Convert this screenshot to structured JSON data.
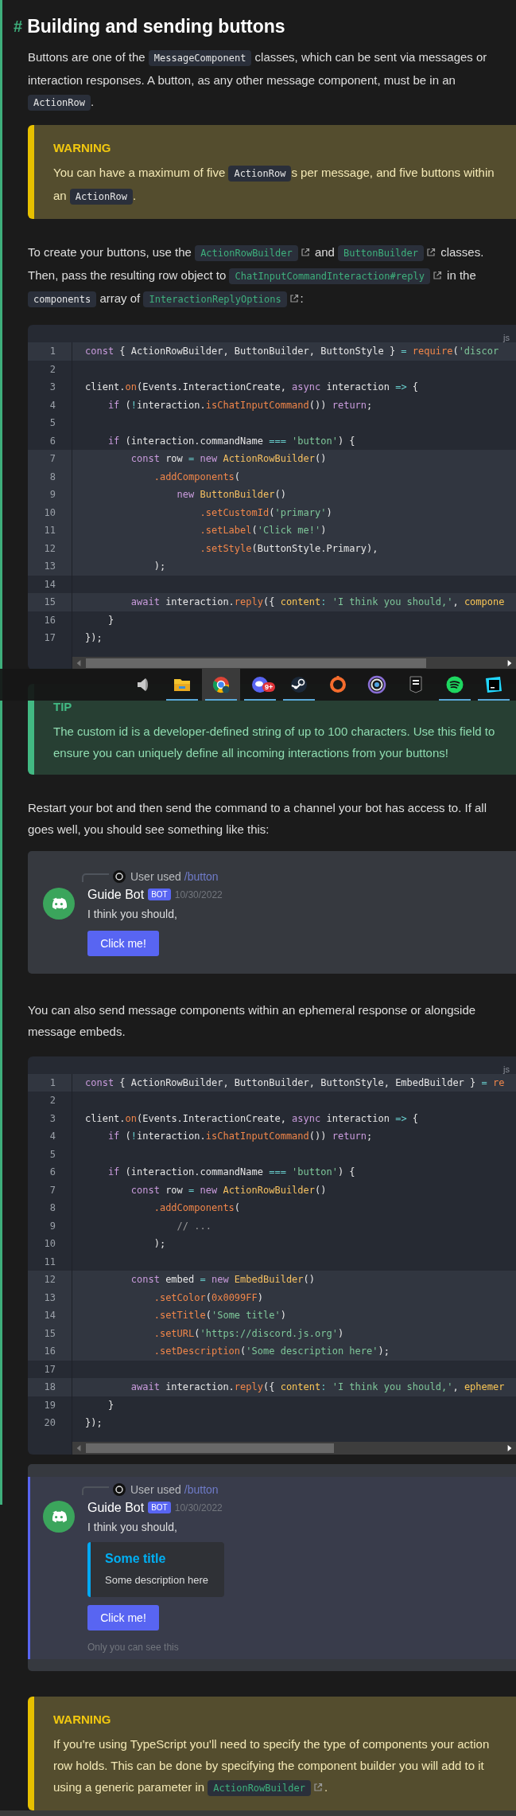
{
  "heading": {
    "anchor": "#",
    "title": "Building and sending buttons"
  },
  "blocks": [
    {
      "kind": "paragraph",
      "segments": [
        {
          "kind": "text",
          "text": "Buttons are one of the "
        },
        {
          "kind": "code",
          "text": "MessageComponent"
        },
        {
          "kind": "text",
          "text": " classes, which can be sent via messages or interaction responses. A button, as any other message component, must be in an "
        },
        {
          "kind": "code",
          "text": "ActionRow"
        },
        {
          "kind": "text",
          "text": "."
        }
      ]
    },
    {
      "kind": "warning",
      "title": "WARNING",
      "segments": [
        {
          "kind": "text",
          "text": "You can have a maximum of five "
        },
        {
          "kind": "code",
          "text": "ActionRow"
        },
        {
          "kind": "text",
          "text": "s per message, and five buttons within an "
        },
        {
          "kind": "code",
          "text": "ActionRow"
        },
        {
          "kind": "text",
          "text": "."
        }
      ]
    },
    {
      "kind": "paragraph",
      "segments": [
        {
          "kind": "text",
          "text": "To create your buttons, use the "
        },
        {
          "kind": "link",
          "text": "ActionRowBuilder"
        },
        {
          "kind": "text",
          "text": " and "
        },
        {
          "kind": "link",
          "text": "ButtonBuilder"
        },
        {
          "kind": "text",
          "text": " classes. Then, pass the resulting row object to "
        },
        {
          "kind": "link",
          "text": "ChatInputCommandInteraction#reply"
        },
        {
          "kind": "text",
          "text": " in the "
        },
        {
          "kind": "code",
          "text": "components"
        },
        {
          "kind": "text",
          "text": " array of "
        },
        {
          "kind": "link",
          "text": "InteractionReplyOptions"
        },
        {
          "kind": "text",
          "text": ":"
        }
      ]
    },
    {
      "kind": "code",
      "language": "js",
      "lines": [
        {
          "n": "1",
          "highlighted": true,
          "tokens": [
            {
              "kind": "kw",
              "text": "const"
            },
            {
              "kind": "p",
              "text": " { ActionRowBuilder, ButtonBuilder, ButtonStyle } "
            },
            {
              "kind": "op",
              "text": "="
            },
            {
              "kind": "fn",
              "text": " require"
            },
            {
              "kind": "p",
              "text": "("
            },
            {
              "kind": "str",
              "text": "'discor"
            }
          ]
        },
        {
          "n": "2",
          "highlighted": false
        },
        {
          "n": "3",
          "highlighted": false,
          "tokens": [
            {
              "kind": "p",
              "text": "client."
            },
            {
              "kind": "fn",
              "text": "on"
            },
            {
              "kind": "p",
              "text": "(Events.InteractionCreate, "
            },
            {
              "kind": "kw",
              "text": "async"
            },
            {
              "kind": "p",
              "text": " interaction "
            },
            {
              "kind": "op",
              "text": "=>"
            },
            {
              "kind": "p",
              "text": " {"
            }
          ]
        },
        {
          "n": "4",
          "highlighted": false,
          "tokens": [
            {
              "kind": "kw",
              "text": "    if"
            },
            {
              "kind": "p",
              "text": " ("
            },
            {
              "kind": "op",
              "text": "!"
            },
            {
              "kind": "p",
              "text": "interaction."
            },
            {
              "kind": "fn",
              "text": "isChatInputCommand"
            },
            {
              "kind": "p",
              "text": "()) "
            },
            {
              "kind": "kw",
              "text": "return"
            },
            {
              "kind": "p",
              "text": ";"
            }
          ]
        },
        {
          "n": "5",
          "highlighted": false
        },
        {
          "n": "6",
          "highlighted": false,
          "tokens": [
            {
              "kind": "kw",
              "text": "    if"
            },
            {
              "kind": "p",
              "text": " (interaction.commandName "
            },
            {
              "kind": "op",
              "text": "==="
            },
            {
              "kind": "str",
              "text": " 'button'"
            },
            {
              "kind": "p",
              "text": ") {"
            }
          ]
        },
        {
          "n": "7",
          "highlighted": true,
          "tokens": [
            {
              "kind": "kw",
              "text": "        const"
            },
            {
              "kind": "p",
              "text": " row "
            },
            {
              "kind": "op",
              "text": "="
            },
            {
              "kind": "kw",
              "text": " new"
            },
            {
              "kind": "cls",
              "text": " ActionRowBuilder"
            },
            {
              "kind": "p",
              "text": "()"
            }
          ]
        },
        {
          "n": "8",
          "highlighted": true,
          "tokens": [
            {
              "kind": "fn",
              "text": "            .addComponents"
            },
            {
              "kind": "p",
              "text": "("
            }
          ]
        },
        {
          "n": "9",
          "highlighted": true,
          "tokens": [
            {
              "kind": "kw",
              "text": "                new"
            },
            {
              "kind": "cls",
              "text": " ButtonBuilder"
            },
            {
              "kind": "p",
              "text": "()"
            }
          ]
        },
        {
          "n": "10",
          "highlighted": true,
          "tokens": [
            {
              "kind": "fn",
              "text": "                    .setCustomId"
            },
            {
              "kind": "p",
              "text": "("
            },
            {
              "kind": "str",
              "text": "'primary'"
            },
            {
              "kind": "p",
              "text": ")"
            }
          ]
        },
        {
          "n": "11",
          "highlighted": true,
          "tokens": [
            {
              "kind": "fn",
              "text": "                    .setLabel"
            },
            {
              "kind": "p",
              "text": "("
            },
            {
              "kind": "str",
              "text": "'Click me!'"
            },
            {
              "kind": "p",
              "text": ")"
            }
          ]
        },
        {
          "n": "12",
          "highlighted": true,
          "tokens": [
            {
              "kind": "fn",
              "text": "                    .setStyle"
            },
            {
              "kind": "p",
              "text": "(ButtonStyle.Primary),"
            }
          ]
        },
        {
          "n": "13",
          "highlighted": true,
          "tokens": [
            {
              "kind": "p",
              "text": "            );"
            }
          ]
        },
        {
          "n": "14",
          "highlighted": false
        },
        {
          "n": "15",
          "highlighted": true,
          "tokens": [
            {
              "kind": "kw",
              "text": "        await"
            },
            {
              "kind": "p",
              "text": " interaction."
            },
            {
              "kind": "fn",
              "text": "reply"
            },
            {
              "kind": "p",
              "text": "({ "
            },
            {
              "kind": "prop",
              "text": "content"
            },
            {
              "kind": "op",
              "text": ":"
            },
            {
              "kind": "str",
              "text": " 'I think you should,'"
            },
            {
              "kind": "p",
              "text": ", "
            },
            {
              "kind": "prop",
              "text": "compone"
            }
          ]
        },
        {
          "n": "16",
          "highlighted": false,
          "tokens": [
            {
              "kind": "p",
              "text": "    }"
            }
          ]
        },
        {
          "n": "17",
          "highlighted": false,
          "tokens": [
            {
              "kind": "p",
              "text": "});"
            }
          ]
        }
      ]
    },
    {
      "kind": "tip",
      "title": "TIP",
      "segments": [
        {
          "kind": "text",
          "text": "The custom id is a developer-defined string of up to 100 characters. Use this field to ensure you can uniquely define all incoming interactions from your buttons!"
        }
      ]
    },
    {
      "kind": "paragraph",
      "segments": [
        {
          "kind": "text",
          "text": "Restart your bot and then send the command to a channel your bot has access to. If all goes well, you should see something like this:"
        }
      ]
    },
    {
      "kind": "discord",
      "ephemeral": false,
      "reply_text": "User used",
      "command": "/button",
      "author": "Guide Bot",
      "tag": "BOT",
      "timestamp": "10/30/2022",
      "content": "I think you should,",
      "button": "Click me!"
    },
    {
      "kind": "paragraph",
      "segments": [
        {
          "kind": "text",
          "text": "You can also send message components within an ephemeral response or alongside message embeds."
        }
      ]
    },
    {
      "kind": "code",
      "language": "js",
      "lines": [
        {
          "n": "1",
          "highlighted": true,
          "tokens": [
            {
              "kind": "kw",
              "text": "const"
            },
            {
              "kind": "p",
              "text": " { ActionRowBuilder, ButtonBuilder, ButtonStyle, EmbedBuilder } "
            },
            {
              "kind": "op",
              "text": "="
            },
            {
              "kind": "fn",
              "text": " re"
            }
          ]
        },
        {
          "n": "2",
          "highlighted": false
        },
        {
          "n": "3",
          "highlighted": false,
          "tokens": [
            {
              "kind": "p",
              "text": "client."
            },
            {
              "kind": "fn",
              "text": "on"
            },
            {
              "kind": "p",
              "text": "(Events.InteractionCreate, "
            },
            {
              "kind": "kw",
              "text": "async"
            },
            {
              "kind": "p",
              "text": " interaction "
            },
            {
              "kind": "op",
              "text": "=>"
            },
            {
              "kind": "p",
              "text": " {"
            }
          ]
        },
        {
          "n": "4",
          "highlighted": false,
          "tokens": [
            {
              "kind": "kw",
              "text": "    if"
            },
            {
              "kind": "p",
              "text": " ("
            },
            {
              "kind": "op",
              "text": "!"
            },
            {
              "kind": "p",
              "text": "interaction."
            },
            {
              "kind": "fn",
              "text": "isChatInputCommand"
            },
            {
              "kind": "p",
              "text": "()) "
            },
            {
              "kind": "kw",
              "text": "return"
            },
            {
              "kind": "p",
              "text": ";"
            }
          ]
        },
        {
          "n": "5",
          "highlighted": false
        },
        {
          "n": "6",
          "highlighted": false,
          "tokens": [
            {
              "kind": "kw",
              "text": "    if"
            },
            {
              "kind": "p",
              "text": " (interaction.commandName "
            },
            {
              "kind": "op",
              "text": "==="
            },
            {
              "kind": "str",
              "text": " 'button'"
            },
            {
              "kind": "p",
              "text": ") {"
            }
          ]
        },
        {
          "n": "7",
          "highlighted": false,
          "tokens": [
            {
              "kind": "kw",
              "text": "        const"
            },
            {
              "kind": "p",
              "text": " row "
            },
            {
              "kind": "op",
              "text": "="
            },
            {
              "kind": "kw",
              "text": " new"
            },
            {
              "kind": "cls",
              "text": " ActionRowBuilder"
            },
            {
              "kind": "p",
              "text": "()"
            }
          ]
        },
        {
          "n": "8",
          "highlighted": false,
          "tokens": [
            {
              "kind": "fn",
              "text": "            .addComponents"
            },
            {
              "kind": "p",
              "text": "("
            }
          ]
        },
        {
          "n": "9",
          "highlighted": false,
          "tokens": [
            {
              "kind": "cm",
              "text": "                // ..."
            }
          ]
        },
        {
          "n": "10",
          "highlighted": false,
          "tokens": [
            {
              "kind": "p",
              "text": "            );"
            }
          ]
        },
        {
          "n": "11",
          "highlighted": false
        },
        {
          "n": "12",
          "highlighted": true,
          "tokens": [
            {
              "kind": "kw",
              "text": "        const"
            },
            {
              "kind": "p",
              "text": " embed "
            },
            {
              "kind": "op",
              "text": "="
            },
            {
              "kind": "kw",
              "text": " new"
            },
            {
              "kind": "cls",
              "text": " EmbedBuilder"
            },
            {
              "kind": "p",
              "text": "()"
            }
          ]
        },
        {
          "n": "13",
          "highlighted": true,
          "tokens": [
            {
              "kind": "fn",
              "text": "            .setColor"
            },
            {
              "kind": "p",
              "text": "("
            },
            {
              "kind": "num",
              "text": "0x0099FF"
            },
            {
              "kind": "p",
              "text": ")"
            }
          ]
        },
        {
          "n": "14",
          "highlighted": true,
          "tokens": [
            {
              "kind": "fn",
              "text": "            .setTitle"
            },
            {
              "kind": "p",
              "text": "("
            },
            {
              "kind": "str",
              "text": "'Some title'"
            },
            {
              "kind": "p",
              "text": ")"
            }
          ]
        },
        {
          "n": "15",
          "highlighted": true,
          "tokens": [
            {
              "kind": "fn",
              "text": "            .setURL"
            },
            {
              "kind": "p",
              "text": "("
            },
            {
              "kind": "str",
              "text": "'https://discord.js.org'"
            },
            {
              "kind": "p",
              "text": ")"
            }
          ]
        },
        {
          "n": "16",
          "highlighted": true,
          "tokens": [
            {
              "kind": "fn",
              "text": "            .setDescription"
            },
            {
              "kind": "p",
              "text": "("
            },
            {
              "kind": "str",
              "text": "'Some description here'"
            },
            {
              "kind": "p",
              "text": ");"
            }
          ]
        },
        {
          "n": "17",
          "highlighted": false
        },
        {
          "n": "18",
          "highlighted": true,
          "tokens": [
            {
              "kind": "kw",
              "text": "        await"
            },
            {
              "kind": "p",
              "text": " interaction."
            },
            {
              "kind": "fn",
              "text": "reply"
            },
            {
              "kind": "p",
              "text": "({ "
            },
            {
              "kind": "prop",
              "text": "content"
            },
            {
              "kind": "op",
              "text": ":"
            },
            {
              "kind": "str",
              "text": " 'I think you should,'"
            },
            {
              "kind": "p",
              "text": ", "
            },
            {
              "kind": "prop",
              "text": "ephemer"
            }
          ]
        },
        {
          "n": "19",
          "highlighted": false,
          "tokens": [
            {
              "kind": "p",
              "text": "    }"
            }
          ]
        },
        {
          "n": "20",
          "highlighted": false,
          "tokens": [
            {
              "kind": "p",
              "text": "});"
            }
          ]
        }
      ]
    },
    {
      "kind": "discord",
      "ephemeral": true,
      "reply_text": "User used",
      "command": "/button",
      "author": "Guide Bot",
      "tag": "BOT",
      "timestamp": "10/30/2022",
      "content": "I think you should,",
      "embed": {
        "title": "Some title",
        "description": "Some description here"
      },
      "button": "Click me!",
      "note": "Only you can see this"
    },
    {
      "kind": "warning",
      "title": "WARNING",
      "segments": [
        {
          "kind": "text",
          "text": "If you're using TypeScript you'll need to specify the type of components your action row holds. This can be done by specifying the component builder you will add to it using a generic parameter in "
        },
        {
          "kind": "link",
          "text": "ActionRowBuilder"
        },
        {
          "kind": "text",
          "text": "."
        }
      ]
    }
  ],
  "taskbar": {
    "apps": [
      {
        "kind": "speaker",
        "running": false,
        "selected": false
      },
      {
        "kind": "folder",
        "running": true,
        "selected": false
      },
      {
        "kind": "browser",
        "running": true,
        "selected": true
      },
      {
        "kind": "chat",
        "running": true,
        "selected": false,
        "badge": "9+"
      },
      {
        "kind": "launcher",
        "running": true,
        "selected": false
      },
      {
        "kind": "ring",
        "running": false,
        "selected": false
      },
      {
        "kind": "swirl",
        "running": false,
        "selected": false
      },
      {
        "kind": "shield",
        "running": false,
        "selected": false
      },
      {
        "kind": "music",
        "running": true,
        "selected": false
      },
      {
        "kind": "editor",
        "running": true,
        "selected": false
      }
    ]
  }
}
